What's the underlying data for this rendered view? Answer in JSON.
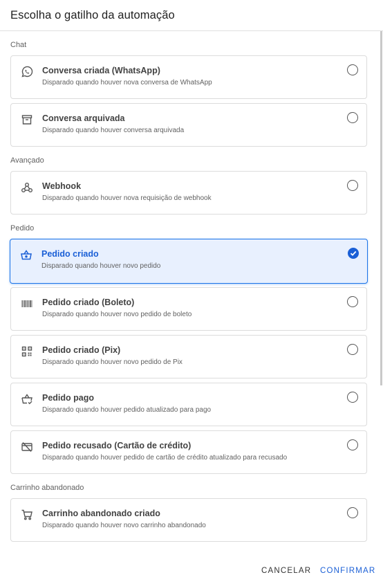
{
  "dialog": {
    "title": "Escolha o gatilho da automação",
    "cancel_label": "CANCELAR",
    "confirm_label": "CONFIRMAR"
  },
  "sections": [
    {
      "label": "Chat"
    },
    {
      "label": "Avançado"
    },
    {
      "label": "Pedido"
    },
    {
      "label": "Carrinho abandonado"
    }
  ],
  "triggers": [
    {
      "icon": "whatsapp-icon",
      "name": "Conversa criada (WhatsApp)",
      "desc": "Disparado quando houver nova conversa de WhatsApp",
      "selected": false
    },
    {
      "icon": "archive-icon",
      "name": "Conversa arquivada",
      "desc": "Disparado quando houver conversa arquivada",
      "selected": false
    },
    {
      "icon": "webhook-icon",
      "name": "Webhook",
      "desc": "Disparado quando houver nova requisição de webhook",
      "selected": false
    },
    {
      "icon": "basket-icon",
      "name": "Pedido criado",
      "desc": "Disparado quando houver novo pedido",
      "selected": true
    },
    {
      "icon": "barcode-icon",
      "name": "Pedido criado (Boleto)",
      "desc": "Disparado quando houver novo pedido de boleto",
      "selected": false
    },
    {
      "icon": "qr-code-icon",
      "name": "Pedido criado (Pix)",
      "desc": "Disparado quando houver novo pedido de Pix",
      "selected": false
    },
    {
      "icon": "basket-check-icon",
      "name": "Pedido pago",
      "desc": "Disparado quando houver pedido atualizado para pago",
      "selected": false
    },
    {
      "icon": "card-off-icon",
      "name": "Pedido recusado (Cartão de crédito)",
      "desc": "Disparado quando houver pedido de cartão de crédito atualizado para recusado",
      "selected": false
    },
    {
      "icon": "cart-icon",
      "name": "Carrinho abandonado criado",
      "desc": "Disparado quando houver novo carrinho abandonado",
      "selected": false
    }
  ],
  "colors": {
    "accent": "#1a5fd6",
    "selected_bg": "#e8f0fe"
  }
}
